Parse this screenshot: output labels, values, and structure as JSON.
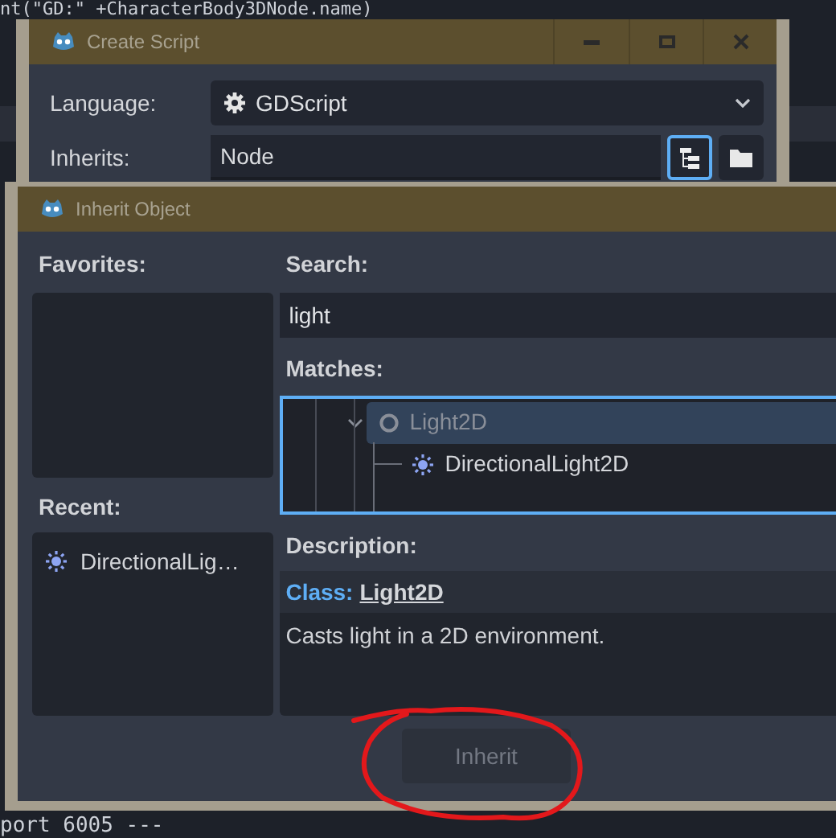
{
  "editor": {
    "lines": [
      {
        "text": "nt(\"GD:\" +CharacterBody3DNode.name)"
      }
    ],
    "bottom_lines": [
      {
        "text": "port 6005 ---"
      }
    ]
  },
  "create_script": {
    "title": "Create Script",
    "language": {
      "label": "Language:",
      "value": "GDScript"
    },
    "inherits": {
      "label": "Inherits:",
      "value": "Node"
    },
    "tree_button_selected": true
  },
  "inherit_object": {
    "title": "Inherit Object",
    "favorites": {
      "label": "Favorites:"
    },
    "recent": {
      "label": "Recent:",
      "items": [
        {
          "label": "DirectionalLig…",
          "kind": "directional",
          "selected": false
        }
      ]
    },
    "search": {
      "label": "Search:",
      "value": "light"
    },
    "matches": {
      "label": "Matches:",
      "items": [
        {
          "label": "Light2D",
          "kind": "base",
          "selected": true,
          "disabled": true,
          "expanded": true,
          "children": [
            {
              "label": "DirectionalLight2D",
              "kind": "directional",
              "selected": false,
              "disabled": false
            }
          ]
        }
      ]
    },
    "description": {
      "label": "Description:",
      "class_label": "Class:",
      "class_name": "Light2D",
      "text": "Casts light in a 2D environment."
    },
    "button": {
      "label": "Inherit",
      "disabled": true
    }
  }
}
